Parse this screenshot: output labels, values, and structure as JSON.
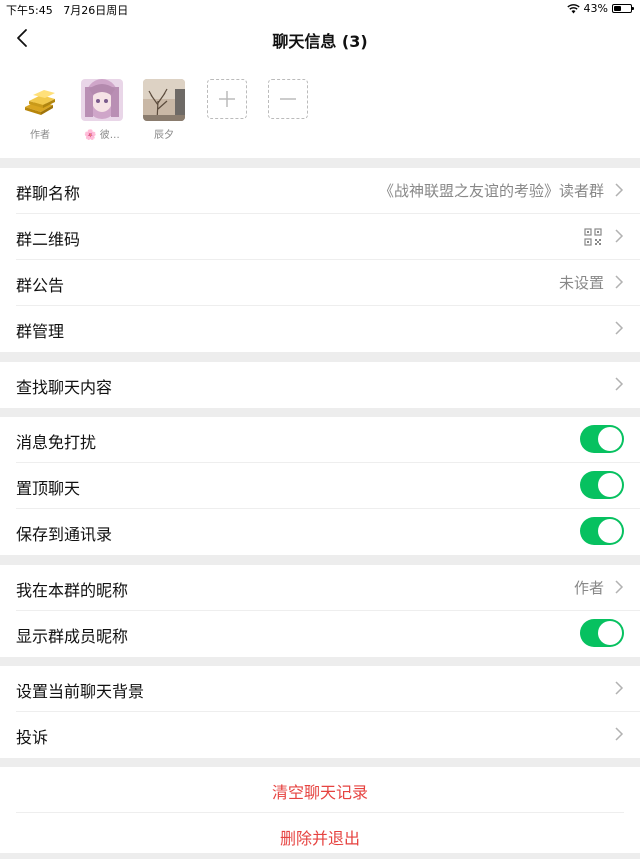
{
  "status_bar": {
    "time": "下午5:45",
    "date": "7月26日周日",
    "battery": "43%",
    "battery_level": 0.43
  },
  "nav": {
    "title": "聊天信息 (3)"
  },
  "members": [
    {
      "name": "作者",
      "icon": "gold-bars-avatar"
    },
    {
      "name": "🌸 彼…",
      "icon": "anime-girl-avatar"
    },
    {
      "name": "辰夕",
      "icon": "bare-tree-avatar"
    }
  ],
  "group1": {
    "name_label": "群聊名称",
    "name_value": "《战神联盟之友谊的考验》读者群",
    "qr_label": "群二维码",
    "notice_label": "群公告",
    "notice_value": "未设置",
    "manage_label": "群管理"
  },
  "group2": {
    "search_label": "查找聊天内容"
  },
  "group3": {
    "mute_label": "消息免打扰",
    "pin_label": "置顶聊天",
    "save_label": "保存到通讯录"
  },
  "group4": {
    "nickname_label": "我在本群的昵称",
    "nickname_value": "作者",
    "show_nick_label": "显示群成员昵称"
  },
  "group5": {
    "bg_label": "设置当前聊天背景",
    "report_label": "投诉"
  },
  "actions": {
    "clear_label": "清空聊天记录",
    "delete_label": "删除并退出"
  },
  "colors": {
    "accent": "#07c160",
    "danger": "#e64340",
    "background": "#ededed"
  }
}
